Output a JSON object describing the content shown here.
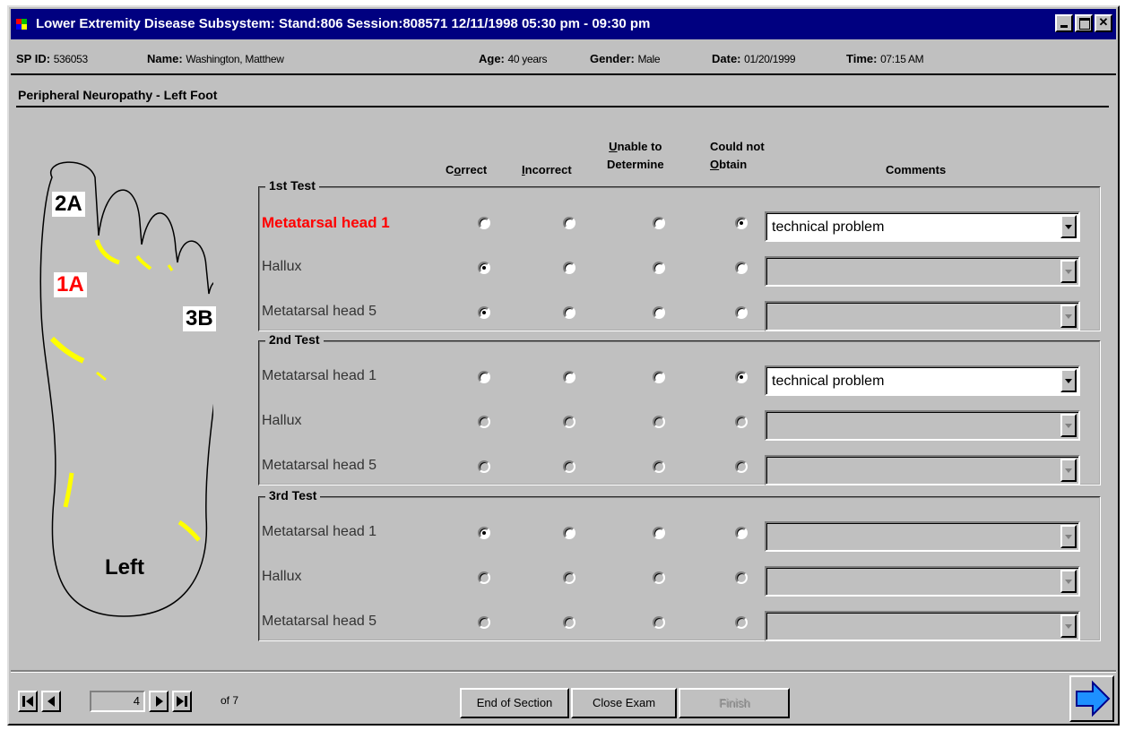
{
  "window": {
    "title": "Lower Extremity Disease Subsystem: Stand:806 Session:808571 12/11/1998 05:30 pm - 09:30 pm"
  },
  "patient": {
    "sp_id_label": "SP ID:",
    "sp_id": "536053",
    "name_label": "Name:",
    "name": "Washington, Matthew",
    "age_label": "Age:",
    "age": "40 years",
    "gender_label": "Gender:",
    "gender": "Male",
    "date_label": "Date:",
    "date": "01/20/1999",
    "time_label": "Time:",
    "time": "07:15 AM"
  },
  "section_title": "Peripheral Neuropathy - Left Foot",
  "foot": {
    "labels": [
      "2A",
      "1A",
      "3B"
    ],
    "side": "Left",
    "outline_color": "#000000",
    "mark_color": "#ffff00",
    "active_label_color": "#ff0000"
  },
  "columns": {
    "correct": {
      "prefix": "C",
      "underlined": "o",
      "suffix": "rrect"
    },
    "incorrect": {
      "prefix": "",
      "underlined": "I",
      "suffix": "ncorrect"
    },
    "unable": {
      "line1_u": "U",
      "line1": "nable to",
      "line2": "Determine"
    },
    "could_not": {
      "line1": "Could not",
      "line2_u": "O",
      "line2": "btain"
    },
    "comments": "Comments"
  },
  "tests": [
    {
      "title": "1st Test",
      "rows": [
        {
          "label": "Metatarsal head 1",
          "selected": 3,
          "comment": "technical problem",
          "active": true,
          "enabled": true
        },
        {
          "label": "Hallux",
          "selected": 0,
          "comment": "",
          "active": false,
          "enabled": true
        },
        {
          "label": "Metatarsal head 5",
          "selected": 0,
          "comment": "",
          "active": false,
          "enabled": true
        }
      ]
    },
    {
      "title": "2nd Test",
      "rows": [
        {
          "label": "Metatarsal head 1",
          "selected": 3,
          "comment": "technical problem",
          "active": false,
          "enabled": true
        },
        {
          "label": "Hallux",
          "selected": -1,
          "comment": "",
          "active": false,
          "enabled": false
        },
        {
          "label": "Metatarsal head 5",
          "selected": -1,
          "comment": "",
          "active": false,
          "enabled": false
        }
      ]
    },
    {
      "title": "3rd Test",
      "rows": [
        {
          "label": "Metatarsal head 1",
          "selected": 0,
          "comment": "",
          "active": false,
          "enabled": true
        },
        {
          "label": "Hallux",
          "selected": -1,
          "comment": "",
          "active": false,
          "enabled": false
        },
        {
          "label": "Metatarsal head 5",
          "selected": -1,
          "comment": "",
          "active": false,
          "enabled": false
        }
      ]
    }
  ],
  "navigation": {
    "current_page": "4",
    "of_label": "of 7"
  },
  "buttons": {
    "end_section": "End of Section",
    "close_exam": "Close Exam",
    "finish": "Finish"
  },
  "colors": {
    "titlebar": "#000080",
    "face": "#c0c0c0",
    "next_arrow": "#1e90ff"
  }
}
